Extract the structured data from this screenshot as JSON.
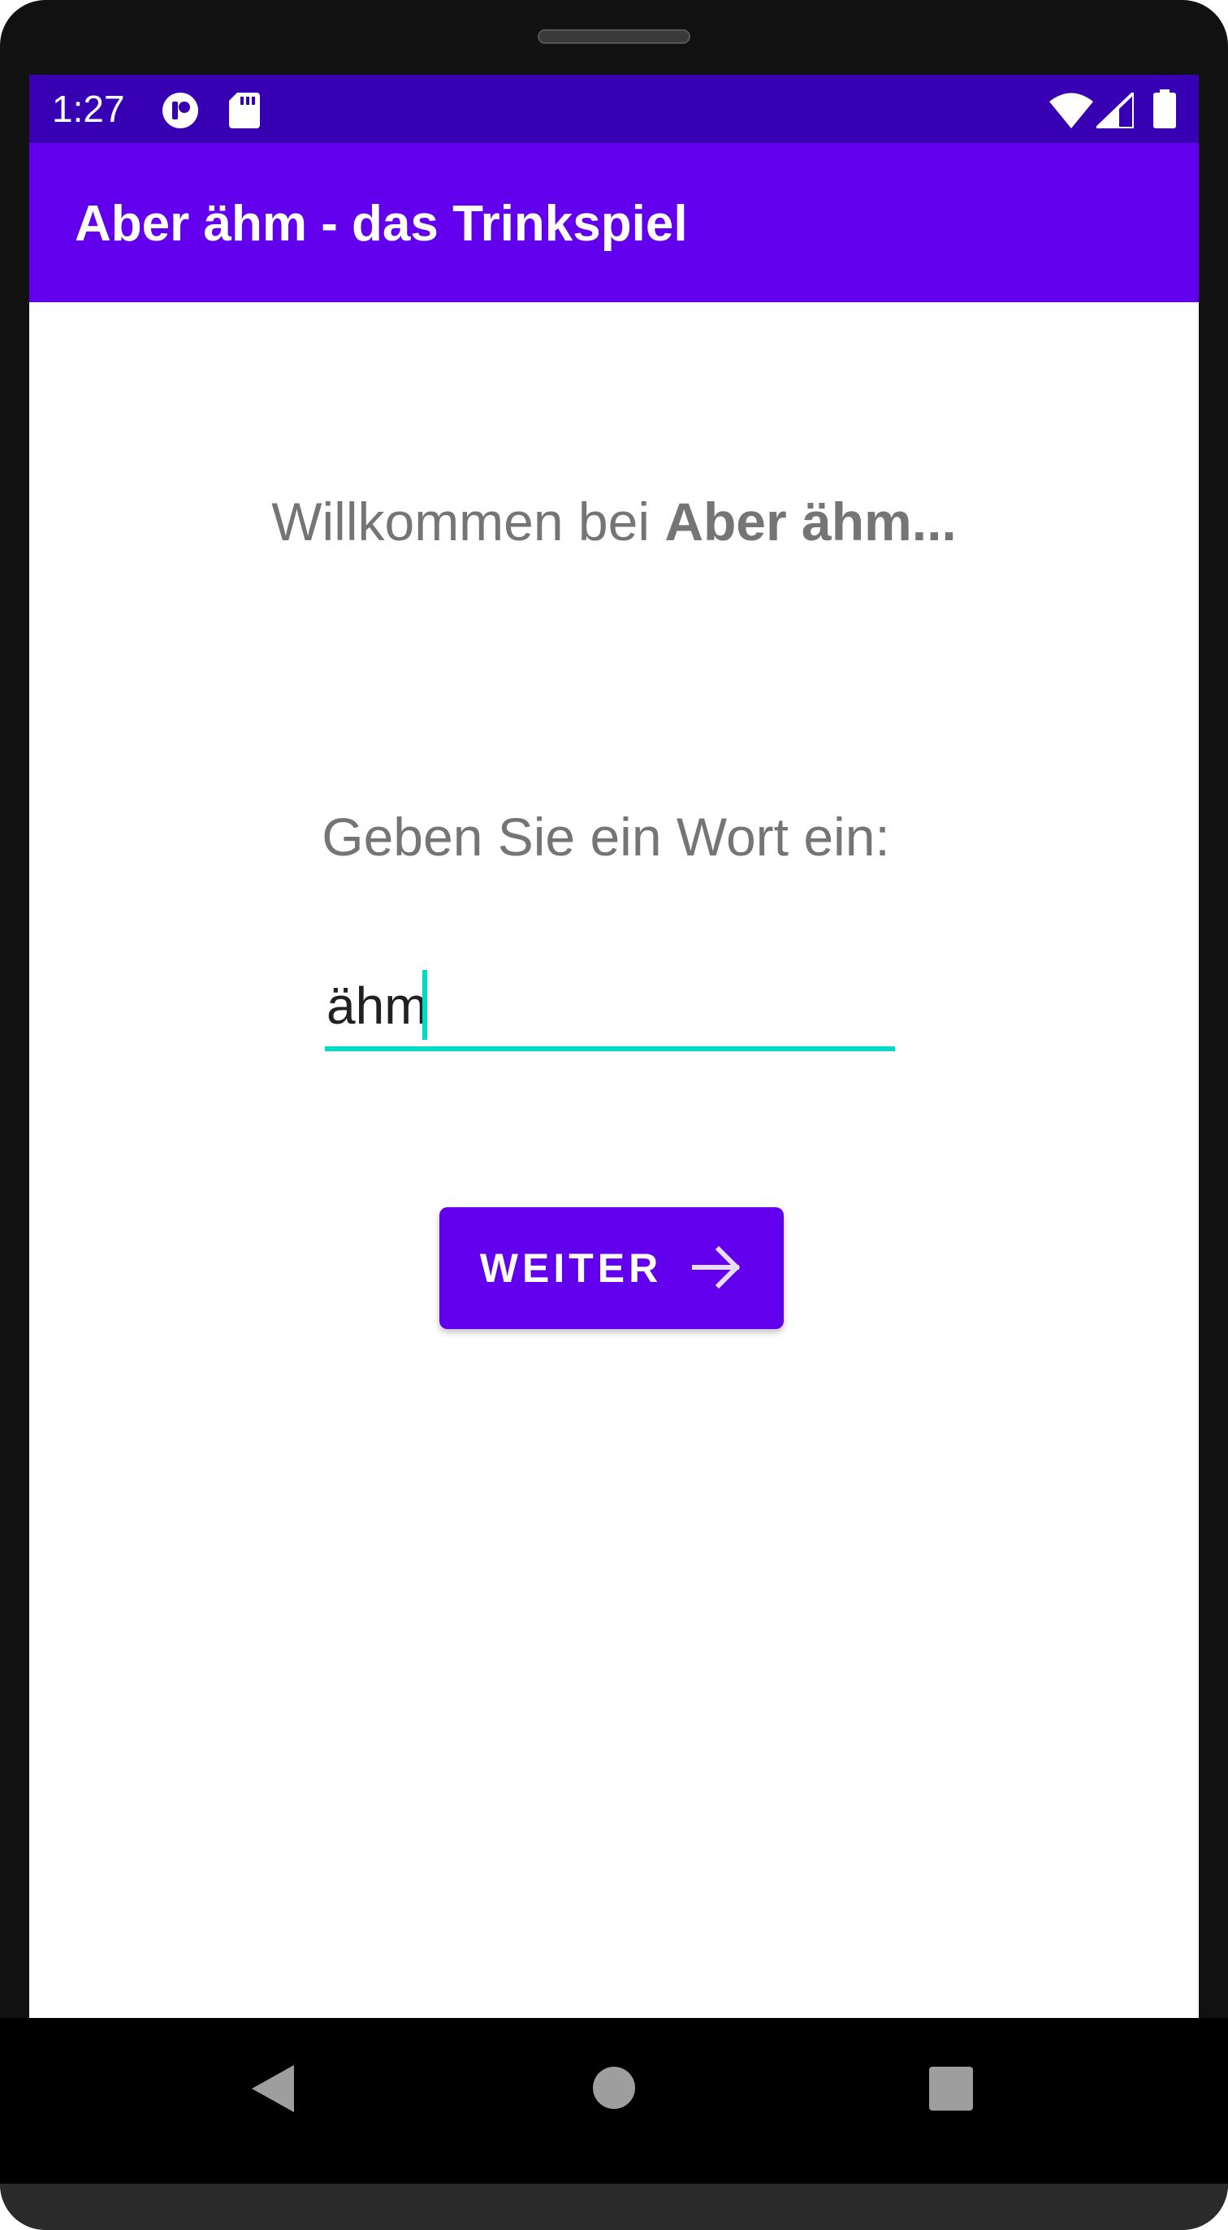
{
  "status_bar": {
    "time": "1:27",
    "icons": [
      "app-notification-icon",
      "sd-card-icon",
      "wifi-icon",
      "cell-signal-icon",
      "battery-icon"
    ]
  },
  "app_bar": {
    "title": "Aber ähm - das Trinkspiel"
  },
  "main": {
    "welcome_prefix": "Willkommen bei ",
    "welcome_bold": "Aber ähm...",
    "prompt": "Geben Sie ein Wort ein:",
    "word_input_value": "ähm",
    "next_button_label": "WEITER",
    "next_button_icon": "arrow-right-icon"
  },
  "navigation_bar": {
    "buttons": [
      "back-icon",
      "home-icon",
      "recents-icon"
    ]
  },
  "colors": {
    "status_bar": "#3700b3",
    "primary": "#6200ee",
    "accent": "#03dac5",
    "secondary_text": "#757575"
  }
}
